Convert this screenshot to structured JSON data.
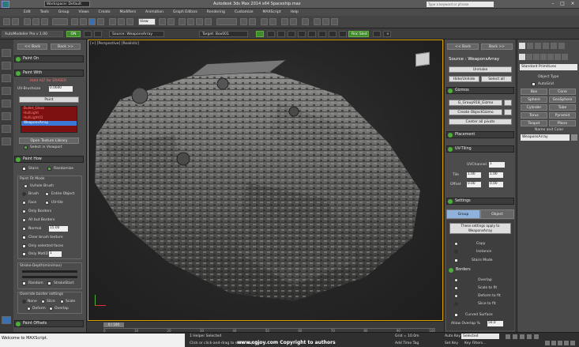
{
  "title_bar": {
    "workspace": "Workspace: Default",
    "title": "Autodesk 3ds Max 2014 x64    Spaceship.max",
    "search_placeholder": "Type a keyword or phrase"
  },
  "menu": [
    "Edit",
    "Tools",
    "Group",
    "Views",
    "Create",
    "Modifiers",
    "Animation",
    "Graph Editors",
    "Rendering",
    "Customize",
    "MAXScript",
    "Help"
  ],
  "toolbar": {
    "view_dropdown": "View"
  },
  "toolbar2": {
    "plugin": "AutoModeller Pro v 1.00",
    "on": "ON",
    "source": "Source: WeaponsArray",
    "target": "Target: Box001",
    "selected": "Rnc Sled"
  },
  "left_panel": {
    "nav_back": "<< Back",
    "nav_fwd": "Back >>",
    "paint_on": "Paint On",
    "paint_with": "Paint With",
    "hold_text": "Hold ALT for ERASER",
    "uv_brushsize_label": "UV-Brushsize",
    "uv_brushsize_val": "0.0600",
    "paint_button": "Paint",
    "list_items": [
      "Bullet_Glass",
      "HullLight",
      "HullLight01",
      "WeaponsArray"
    ],
    "open_texture": "Open Texture Library",
    "select_in_viewport": "Select in Viewport",
    "paint_how": "Paint How",
    "stairs": "Stairs",
    "randomize": "Randomize",
    "paint_fit_mode": "Paint Fit Mode",
    "uv_brush": "Uvhole Brush",
    "brush": "Brush",
    "entire_object": "Entire Object",
    "face": "Face",
    "uv_tile": "UV-tile",
    "only_borders": "Only Borders",
    "all_but_borders": "All but Borders",
    "normal": "Normal",
    "normal_val": "15.00",
    "clear_brush": "Clear brush texture",
    "only_selected_faces": "Only selected faces",
    "only_matid": "Only MatID",
    "matid_val": "1",
    "stroke_depth": "Stroke-Depth(min/max)",
    "random": "Random",
    "stroke_start": "StrokeStart",
    "override_border": "Override border settings",
    "none": "None",
    "slice": "Slice",
    "scale": "Scale",
    "deform": "Deform",
    "overlap": "Overlap",
    "paint_offsets": "Paint Offsets"
  },
  "viewport": {
    "label": "[+] [Perspective] [Realistic]"
  },
  "mid_panel": {
    "nav_back": "<< Back",
    "nav_fwd": "Back >>",
    "source": "Source : WeaponsArray",
    "unmake": "Unmake",
    "hide_unhide": "Hide/Unhide",
    "select_all": "Select all",
    "gizmos": "Gizmos",
    "gizmo1": "G_Group918_Gizmo",
    "create_gizmo": "Create ObjectGizmo",
    "center_pivots": "Center all pivots",
    "placement": "Placement",
    "uv_tiling": "UV-Tiling",
    "uv_channel": "UVChannel",
    "uv_channel_val": "1",
    "tile": "Tile",
    "tile_u": "1.00",
    "tile_v": "1.00",
    "offset": "Offset",
    "offset_u": "0.00",
    "offset_v": "0.00",
    "settings": "Settings",
    "group": "Group",
    "object": "Object",
    "apply_text": "These settings apply to WeaponsArray",
    "copy": "Copy",
    "instance": "Instance",
    "stairs_mode": "Stairs Mode",
    "borders": "Borders",
    "overlap": "Overlap",
    "scale_to_fit": "Scale to fit",
    "deform_to_fit": "Deform to fit",
    "slice_to_fit": "Slice to fit",
    "curved_surface": "Curved Surface",
    "allow_overlap": "Allow Overlap %",
    "allow_overlap_val": "50.0"
  },
  "right_panel": {
    "dropdown": "Standard Primitives",
    "object_type": "Object Type",
    "autogrid": "AutoGrid",
    "primitives": [
      "Box",
      "Cone",
      "Sphere",
      "GeoSphere",
      "Cylinder",
      "Tube",
      "Torus",
      "Pyramid",
      "Teapot",
      "Plane"
    ],
    "name_and_color": "Name and Color",
    "name_val": "WeaponsArray"
  },
  "timeline": {
    "frame": "0 / 100",
    "ticks": [
      "0",
      "10",
      "20",
      "30",
      "40",
      "50",
      "60",
      "70",
      "80",
      "90",
      "100"
    ]
  },
  "status": {
    "maxscript": "Welcome to MAXScript.",
    "selected": "1 Helper Selected",
    "hint": "Click or click-and-drag to select objects",
    "watermark": "www.cgjoy.com Copyright to authors",
    "grid": "Grid = 10.0m",
    "auto_key": "Auto Key",
    "selected_dd": "Selected",
    "set_key": "Set Key",
    "key_filters": "Key Filters...",
    "add_time_tag": "Add Time Tag"
  },
  "colors": {
    "accent_green": "#4caf3a",
    "viewport_border": "#d8a000",
    "list_bg": "#7d1010"
  }
}
